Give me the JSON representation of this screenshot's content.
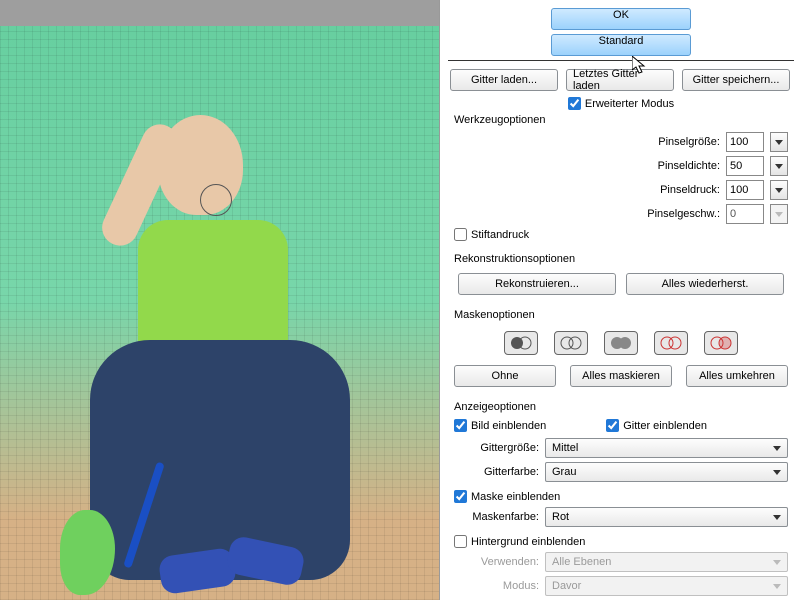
{
  "buttons": {
    "ok": "OK",
    "standard": "Standard",
    "grid_load": "Gitter laden...",
    "grid_last": "Letztes Gitter laden",
    "grid_save": "Gitter speichern...",
    "reconstruct": "Rekonstruieren...",
    "restore_all": "Alles wiederherst.",
    "mask_none": "Ohne",
    "mask_all": "Alles maskieren",
    "mask_invert": "Alles umkehren"
  },
  "checkboxes": {
    "advanced_mode": {
      "label": "Erweiterter Modus",
      "checked": true
    },
    "pen_pressure": {
      "label": "Stiftandruck",
      "checked": false
    },
    "show_image": {
      "label": "Bild einblenden",
      "checked": true
    },
    "show_grid": {
      "label": "Gitter einblenden",
      "checked": true
    },
    "show_mask": {
      "label": "Maske einblenden",
      "checked": true
    },
    "show_bg": {
      "label": "Hintergrund einblenden",
      "checked": false
    }
  },
  "sections": {
    "tool": "Werkzeugoptionen",
    "recon": "Rekonstruktionsoptionen",
    "mask": "Maskenoptionen",
    "display": "Anzeigeoptionen"
  },
  "tool": {
    "brush_size": {
      "label": "Pinselgröße:",
      "value": "100"
    },
    "brush_density": {
      "label": "Pinseldichte:",
      "value": "50"
    },
    "brush_pressure": {
      "label": "Pinseldruck:",
      "value": "100"
    },
    "brush_rate": {
      "label": "Pinselgeschw.:",
      "value": "0",
      "disabled": true
    }
  },
  "display": {
    "grid_size": {
      "label": "Gittergröße:",
      "value": "Mittel"
    },
    "grid_color": {
      "label": "Gitterfarbe:",
      "value": "Grau"
    },
    "mask_color": {
      "label": "Maskenfarbe:",
      "value": "Rot"
    },
    "use": {
      "label": "Verwenden:",
      "value": "Alle Ebenen",
      "disabled": true
    },
    "mode": {
      "label": "Modus:",
      "value": "Davor",
      "disabled": true
    }
  },
  "mask_icons": [
    "mask-replace",
    "mask-add",
    "mask-subtract",
    "mask-intersect",
    "mask-invert"
  ]
}
